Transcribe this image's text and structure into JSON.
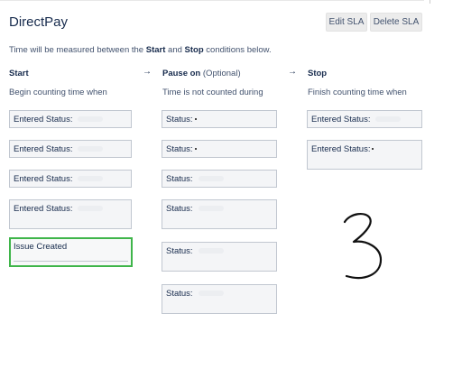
{
  "header": {
    "title": "DirectPay",
    "edit_label": "Edit SLA",
    "delete_label": "Delete SLA"
  },
  "intro": {
    "prefix": "Time will be measured between the ",
    "start_word": "Start",
    "middle": " and ",
    "stop_word": "Stop",
    "suffix": " conditions below."
  },
  "columns": {
    "start": {
      "title": "Start",
      "subtitle": "Begin counting time when",
      "conditions": [
        "Entered Status:",
        "Entered Status:",
        "Entered Status:",
        "Entered Status:",
        "Issue Created"
      ]
    },
    "pause": {
      "title": "Pause on",
      "optional": "(Optional)",
      "subtitle": "Time is not counted during",
      "conditions": [
        "Status:",
        "Status:",
        "Status:",
        "Status:",
        "Status:",
        "Status:"
      ]
    },
    "stop": {
      "title": "Stop",
      "subtitle": "Finish counting time when",
      "conditions": [
        "Entered Status:",
        "Entered Status:"
      ]
    }
  },
  "arrows": [
    "→",
    "→"
  ],
  "annotation": {
    "handwritten_text": "3",
    "highlight_color": "#3fb54a"
  },
  "colors": {
    "text": "#172b4d",
    "muted": "#42526e",
    "field_bg": "#f4f5f7",
    "field_border": "#c1c7d0"
  }
}
